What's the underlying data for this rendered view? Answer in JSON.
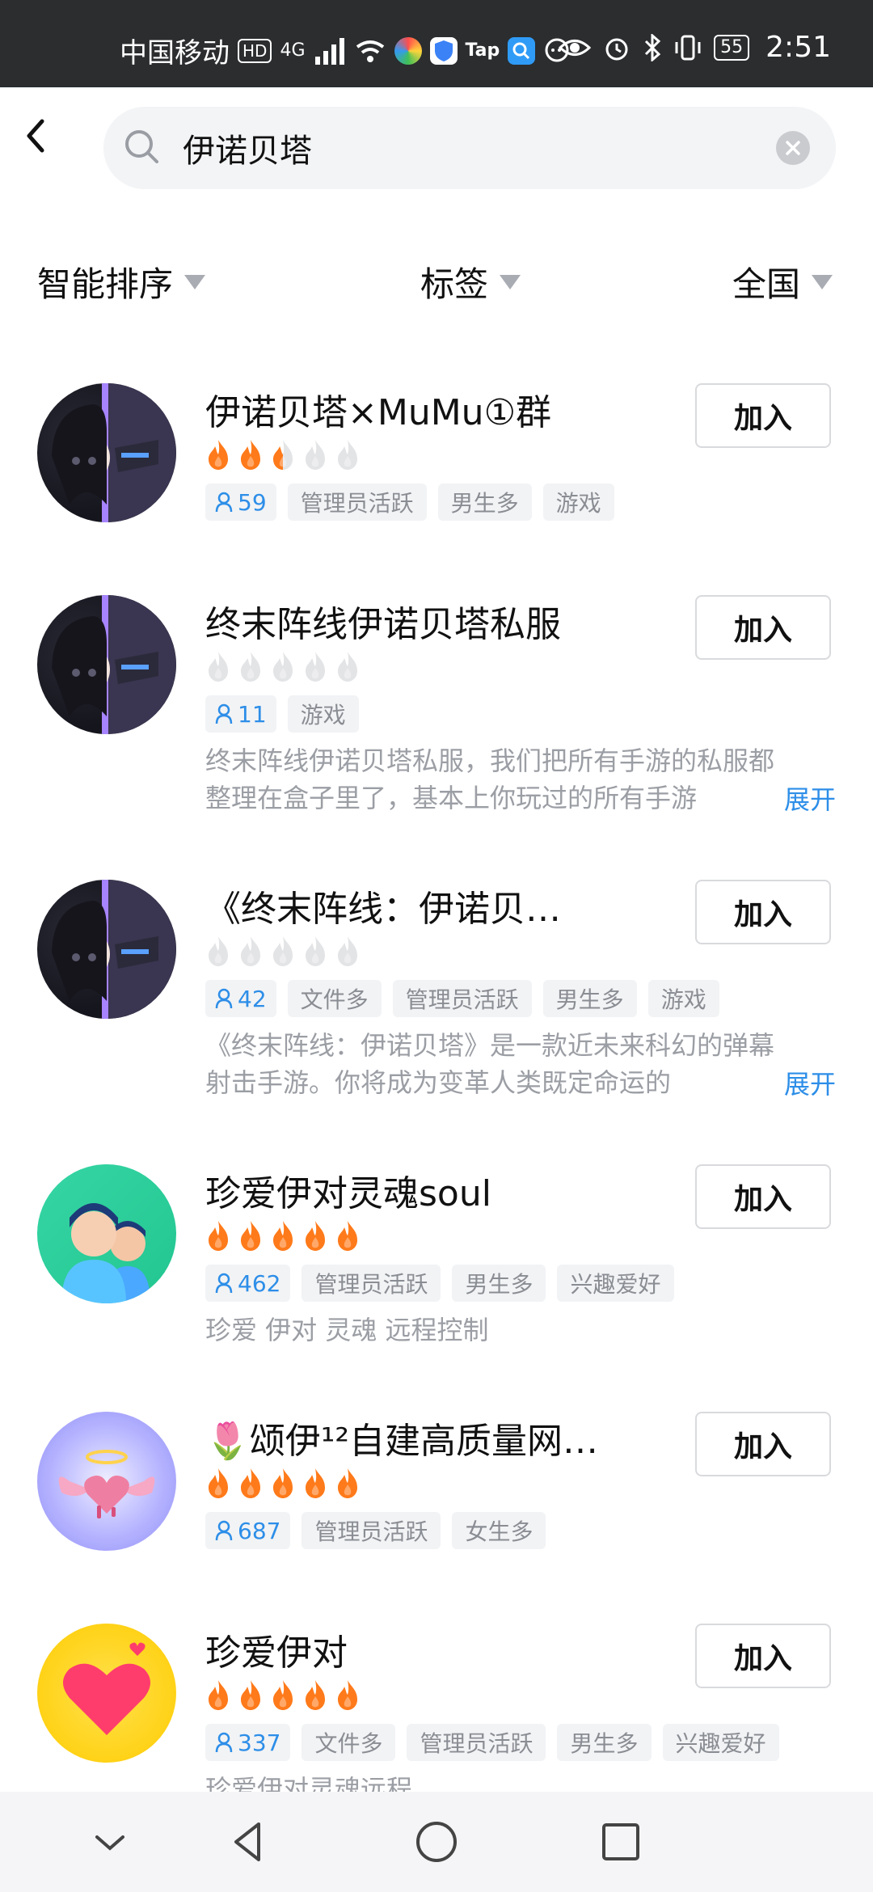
{
  "status_bar": {
    "carrier": "中国移动",
    "hd": "HD",
    "network": "4G",
    "tap": "Tap",
    "battery": "55",
    "time": "2:51"
  },
  "search": {
    "query": "伊诺贝塔"
  },
  "filters": [
    {
      "label": "智能排序"
    },
    {
      "label": "标签"
    },
    {
      "label": "全国"
    }
  ],
  "join_label": "加入",
  "expand_label": "展开",
  "results": [
    {
      "title": "伊诺贝塔×MuMu①群",
      "flames_lit": 2.5,
      "members": "59",
      "tags": [
        "管理员活跃",
        "男生多",
        "游戏"
      ],
      "desc": []
    },
    {
      "title": "终末阵线伊诺贝塔私服",
      "flames_lit": 0,
      "members": "11",
      "tags": [
        "游戏"
      ],
      "desc": [
        "终末阵线伊诺贝塔私服，我们把所有手游的私服都",
        "整理在盒子里了，基本上你玩过的所有手游"
      ]
    },
    {
      "title": "《终末阵线：伊诺贝…",
      "flames_lit": 0,
      "members": "42",
      "tags": [
        "文件多",
        "管理员活跃",
        "男生多",
        "游戏"
      ],
      "desc": [
        "《终末阵线：伊诺贝塔》是一款近未来科幻的弹幕",
        "射击手游。你将成为变革人类既定命运的"
      ]
    },
    {
      "title": "珍爱伊对灵魂soul",
      "flames_lit": 5,
      "members": "462",
      "tags": [
        "管理员活跃",
        "男生多",
        "兴趣爱好"
      ],
      "desc": [
        "珍爱 伊对 灵魂 远程控制"
      ]
    },
    {
      "title": "🌷颂伊¹²自建高质量网…",
      "flames_lit": 5,
      "members": "687",
      "tags": [
        "管理员活跃",
        "女生多"
      ],
      "desc": []
    },
    {
      "title": "珍爱伊对",
      "flames_lit": 5,
      "members": "337",
      "tags": [
        "文件多",
        "管理员活跃",
        "男生多",
        "兴趣爱好"
      ],
      "desc": [
        "珍爱伊对灵魂远程"
      ]
    }
  ],
  "colors": {
    "accent_blue": "#2d8ee8",
    "flame_lit": "#ff7a1a",
    "flame_unlit": "#e3e4e6"
  }
}
